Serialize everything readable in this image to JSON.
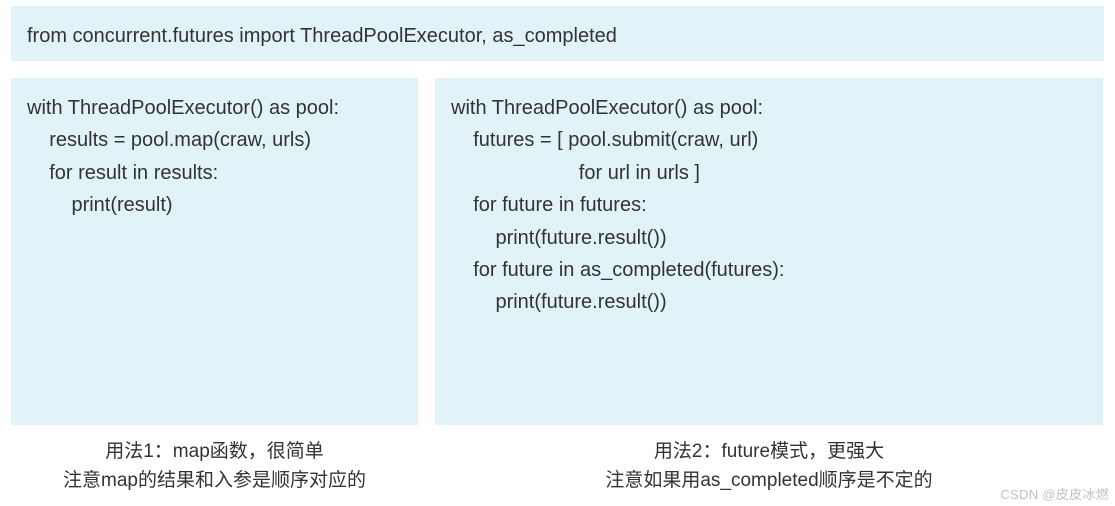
{
  "header": {
    "code": "from concurrent.futures import ThreadPoolExecutor, as_completed"
  },
  "left": {
    "lines": [
      "with ThreadPoolExecutor() as pool:",
      "",
      "    results = pool.map(craw, urls)",
      "",
      "    for result in results:",
      "        print(result)"
    ],
    "caption_line1": "用法1：map函数，很简单",
    "caption_line2": "注意map的结果和入参是顺序对应的"
  },
  "right": {
    "lines": [
      "with ThreadPoolExecutor() as pool:",
      "",
      "    futures = [ pool.submit(craw, url)",
      "                       for url in urls ]",
      "",
      "    for future in futures:",
      "        print(future.result())",
      "    for future in as_completed(futures):",
      "        print(future.result())"
    ],
    "caption_line1": "用法2：future模式，更强大",
    "caption_line2": "注意如果用as_completed顺序是不定的"
  },
  "watermark": "CSDN @皮皮冰燃"
}
